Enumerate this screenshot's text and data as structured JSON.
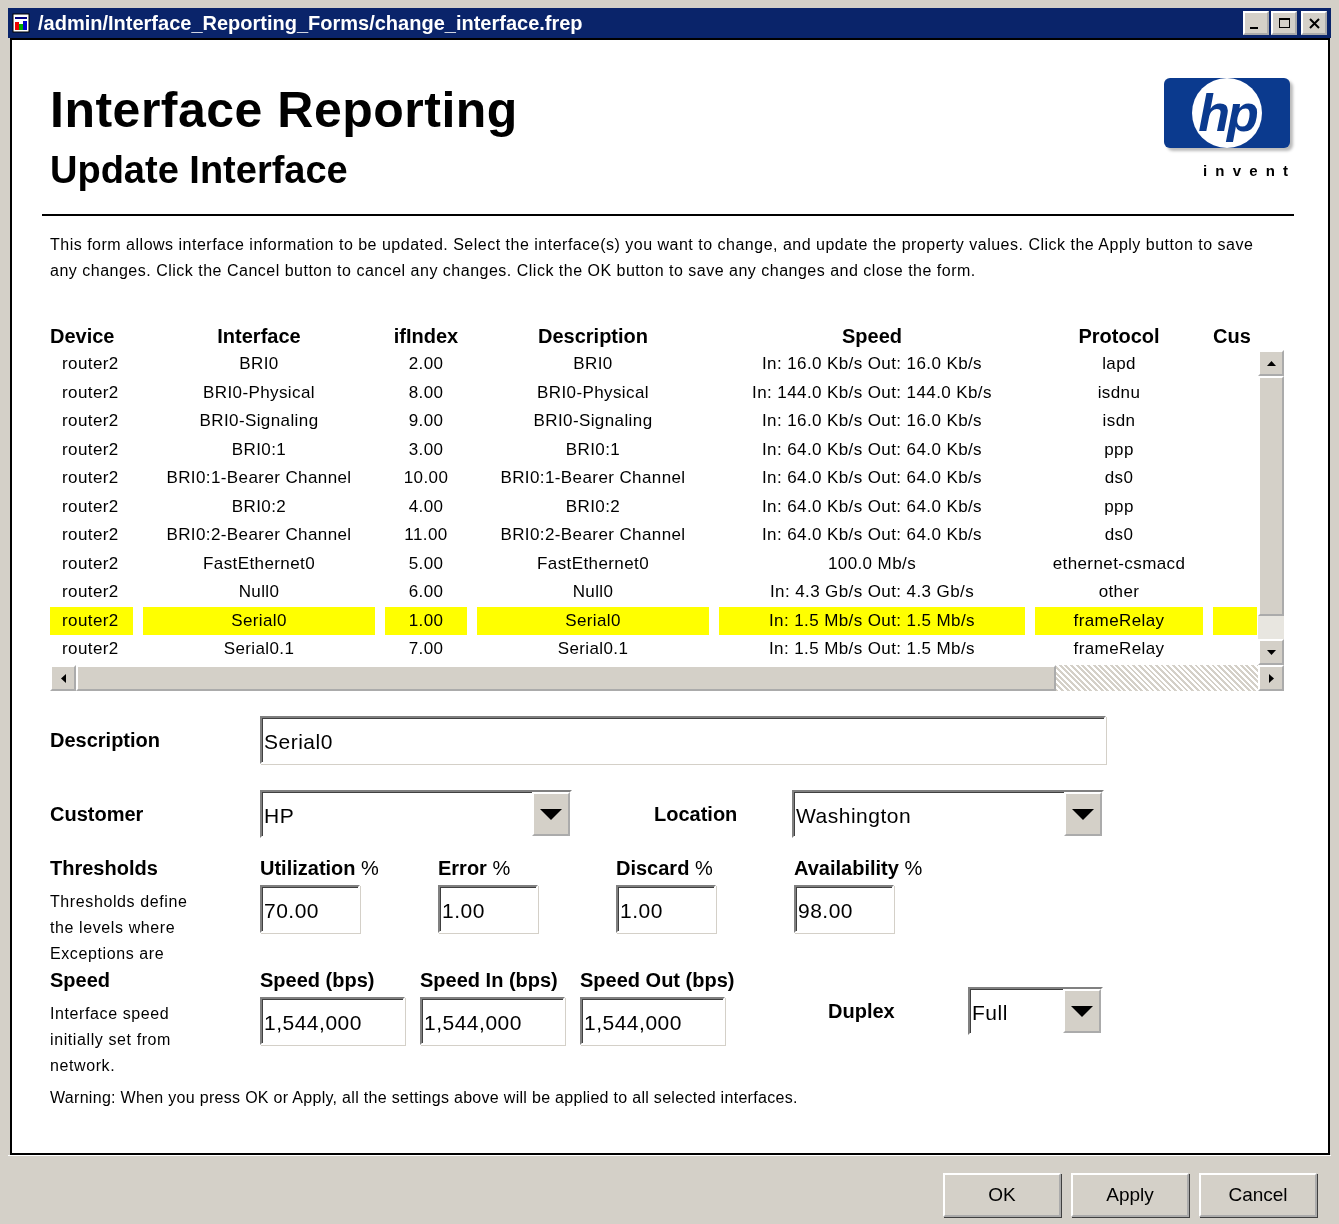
{
  "window": {
    "title": "/admin/Interface_Reporting_Forms/change_interface.frep"
  },
  "header": {
    "title": "Interface Reporting",
    "subtitle": "Update Interface",
    "logo": {
      "mark": "hp",
      "tagline": "i n v e n t"
    }
  },
  "intro": "This form allows interface information to be updated. Select the interface(s) you want to change, and update the property values. Click the Apply button to save any changes. Click the Cancel button to cancel any changes. Click the OK button to save any changes and close the form.",
  "table": {
    "columns": [
      "Device",
      "Interface",
      "ifIndex",
      "Description",
      "Speed",
      "Protocol",
      "Cus"
    ],
    "rows": [
      {
        "cells": [
          "router2",
          "BRI0",
          "2.00",
          "BRI0",
          "In: 16.0 Kb/s Out: 16.0 Kb/s",
          "lapd"
        ],
        "selected": false
      },
      {
        "cells": [
          "router2",
          "BRI0-Physical",
          "8.00",
          "BRI0-Physical",
          "In: 144.0 Kb/s Out: 144.0 Kb/s",
          "isdnu"
        ],
        "selected": false
      },
      {
        "cells": [
          "router2",
          "BRI0-Signaling",
          "9.00",
          "BRI0-Signaling",
          "In: 16.0 Kb/s Out: 16.0 Kb/s",
          "isdn"
        ],
        "selected": false
      },
      {
        "cells": [
          "router2",
          "BRI0:1",
          "3.00",
          "BRI0:1",
          "In: 64.0 Kb/s Out: 64.0 Kb/s",
          "ppp"
        ],
        "selected": false
      },
      {
        "cells": [
          "router2",
          "BRI0:1-Bearer Channel",
          "10.00",
          "BRI0:1-Bearer Channel",
          "In: 64.0 Kb/s Out: 64.0 Kb/s",
          "ds0"
        ],
        "selected": false
      },
      {
        "cells": [
          "router2",
          "BRI0:2",
          "4.00",
          "BRI0:2",
          "In: 64.0 Kb/s Out: 64.0 Kb/s",
          "ppp"
        ],
        "selected": false
      },
      {
        "cells": [
          "router2",
          "BRI0:2-Bearer Channel",
          "11.00",
          "BRI0:2-Bearer Channel",
          "In: 64.0 Kb/s Out: 64.0 Kb/s",
          "ds0"
        ],
        "selected": false
      },
      {
        "cells": [
          "router2",
          "FastEthernet0",
          "5.00",
          "FastEthernet0",
          "100.0 Mb/s",
          "ethernet-csmacd"
        ],
        "selected": false
      },
      {
        "cells": [
          "router2",
          "Null0",
          "6.00",
          "Null0",
          "In: 4.3 Gb/s Out: 4.3 Gb/s",
          "other"
        ],
        "selected": false
      },
      {
        "cells": [
          "router2",
          "Serial0",
          "1.00",
          "Serial0",
          "In: 1.5 Mb/s Out: 1.5 Mb/s",
          "frameRelay"
        ],
        "selected": true
      },
      {
        "cells": [
          "router2",
          "Serial0.1",
          "7.00",
          "Serial0.1",
          "In: 1.5 Mb/s Out: 1.5 Mb/s",
          "frameRelay"
        ],
        "selected": false
      }
    ]
  },
  "form": {
    "description": {
      "label": "Description",
      "value": "Serial0"
    },
    "customer": {
      "label": "Customer",
      "value": "HP"
    },
    "location": {
      "label": "Location",
      "value": "Washington"
    },
    "thresholds": {
      "label": "Thresholds",
      "note": "Thresholds define the levels where Exceptions are",
      "fields": [
        {
          "label": "**Utilization** %",
          "value": "70.00"
        },
        {
          "label": "**Error** %",
          "value": "1.00"
        },
        {
          "label": "**Discard** %",
          "value": "1.00"
        },
        {
          "label": "**Availability** %",
          "value": "98.00"
        }
      ]
    },
    "speed": {
      "label": "Speed",
      "note": "Interface speed initially set from network.",
      "fields": [
        {
          "label": "**Speed (bps)**",
          "value": "1,544,000"
        },
        {
          "label": "**Speed In (bps)**",
          "value": "1,544,000"
        },
        {
          "label": "**Speed Out (bps)**",
          "value": "1,544,000"
        }
      ]
    },
    "duplex": {
      "label": "Duplex",
      "value": "Full"
    }
  },
  "warning": "Warning: When you press OK or Apply, all the settings above will be applied to all selected interfaces.",
  "buttons": [
    "OK",
    "Apply",
    "Cancel"
  ]
}
